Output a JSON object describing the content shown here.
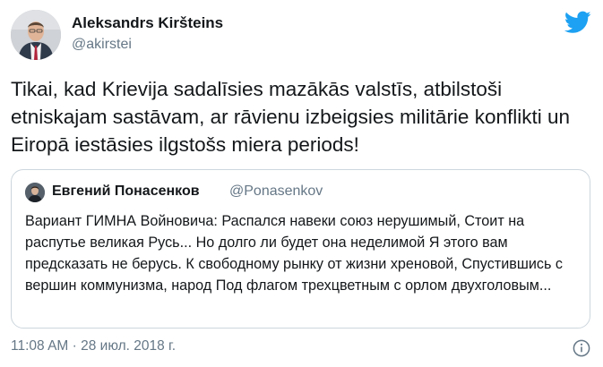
{
  "author": {
    "name": "Aleksandrs Kiršteins",
    "handle": "@akirstei",
    "avatar": "profile-photo"
  },
  "brand": {
    "icon": "twitter-bird-icon",
    "color": "#1da1f2"
  },
  "tweet": {
    "text": "Tikai, kad Krievija sadalīsies mazākās valstīs, atbilstoši etniskajam sastāvam, ar rāvienu izbeigsies militārie konflikti un Eiropā iestāsies ilgstošs miera periods!"
  },
  "quoted": {
    "name": "Евгений Понасенков",
    "handle": "@Ponasenkov",
    "avatar": "profile-photo",
    "text": "Вариант ГИМНА Войновича: Распался навеки союз нерушимый, Стоит на распутье великая Русь... Но долго ли будет она неделимой Я этого вам предсказать не берусь. К свободному рынку от жизни хреновой, Спустившись с вершин коммунизма, народ Под флагом трехцветным с орлом двухголовым..."
  },
  "footer": {
    "timestamp": "11:08 AM · 28 июл. 2018 г.",
    "info_icon": "info-icon"
  },
  "colors": {
    "text": "#14171a",
    "secondary": "#657786",
    "border": "#ccd6dd",
    "accent": "#1da1f2"
  }
}
